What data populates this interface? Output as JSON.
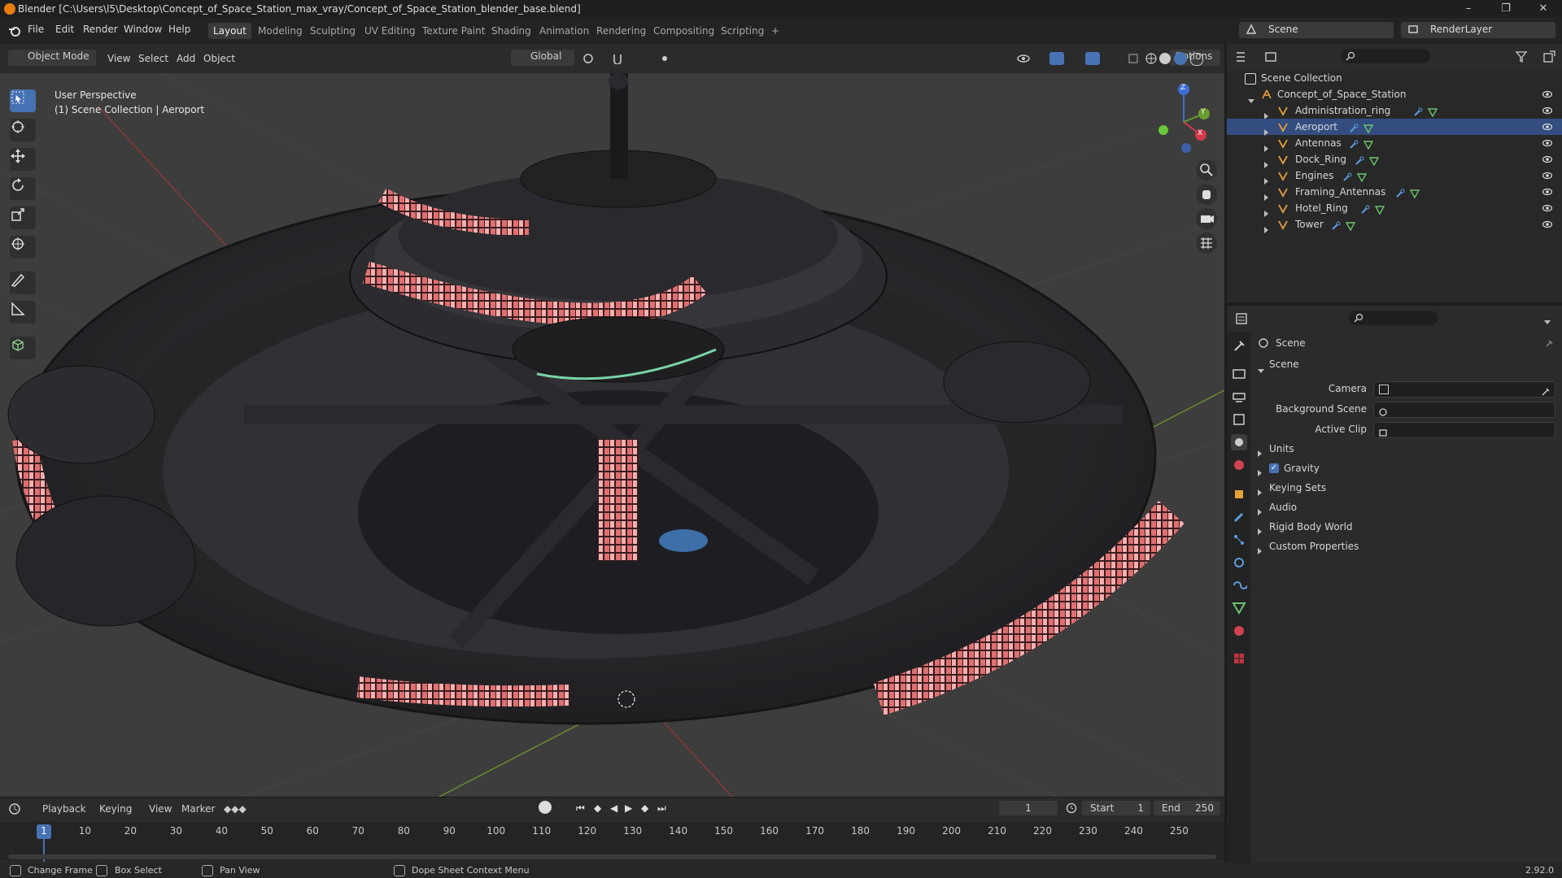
{
  "window": {
    "title": "Blender [C:\\Users\\l5\\Desktop\\Concept_of_Space_Station_max_vray/Concept_of_Space_Station_blender_base.blend]",
    "controls": [
      "–",
      "❐",
      "✕"
    ]
  },
  "menubar": {
    "menus": [
      "File",
      "Edit",
      "Render",
      "Window",
      "Help"
    ],
    "workspaces": [
      "Layout",
      "Modeling",
      "Sculpting",
      "UV Editing",
      "Texture Paint",
      "Shading",
      "Animation",
      "Rendering",
      "Compositing",
      "Scripting"
    ],
    "active_workspace": "Layout",
    "add_tab": "+",
    "scene": "Scene",
    "view_layer": "RenderLayer"
  },
  "viewport_header": {
    "mode": "Object Mode",
    "menus": [
      "View",
      "Select",
      "Add",
      "Object"
    ],
    "orientation": "Global",
    "options": "Options"
  },
  "viewport": {
    "perspective": "User Perspective",
    "collection": "(1) Scene Collection | Aeroport",
    "gizmo_axes": [
      "X",
      "Y",
      "Z"
    ],
    "colors": {
      "background": "#3d3d3d",
      "grid": "#484848",
      "x_axis": "#8b3a3a",
      "y_axis": "#6a8a2e",
      "accent": "#4772b3"
    }
  },
  "outliner": {
    "root": "Scene Collection",
    "collection": "Concept_of_Space_Station",
    "objects": [
      "Administration_ring",
      "Aeroport",
      "Antennas",
      "Dock_Ring",
      "Engines",
      "Framing_Antennas",
      "Hotel_Ring",
      "Tower"
    ]
  },
  "properties": {
    "context": "Scene",
    "section": "Scene",
    "fields": [
      {
        "label": "Camera",
        "value": ""
      },
      {
        "label": "Background Scene",
        "value": ""
      },
      {
        "label": "Active Clip",
        "value": ""
      }
    ],
    "panels": [
      "Units",
      "Gravity",
      "Keying Sets",
      "Audio",
      "Rigid Body World",
      "Custom Properties"
    ],
    "gravity_checked": true
  },
  "timeline": {
    "menus": [
      "Playback",
      "Keying",
      "View",
      "Marker"
    ],
    "current_frame": "1",
    "start_label": "Start",
    "start": "1",
    "end_label": "End",
    "end": "250",
    "ticks": [
      "1",
      "10",
      "20",
      "30",
      "40",
      "50",
      "60",
      "70",
      "80",
      "90",
      "100",
      "110",
      "120",
      "130",
      "140",
      "150",
      "160",
      "170",
      "180",
      "190",
      "200",
      "210",
      "220",
      "230",
      "240",
      "250"
    ]
  },
  "statusbar": {
    "items": [
      "Change Frame",
      "Box Select",
      "Pan View",
      "Dope Sheet Context Menu"
    ],
    "version": "2.92.0"
  }
}
